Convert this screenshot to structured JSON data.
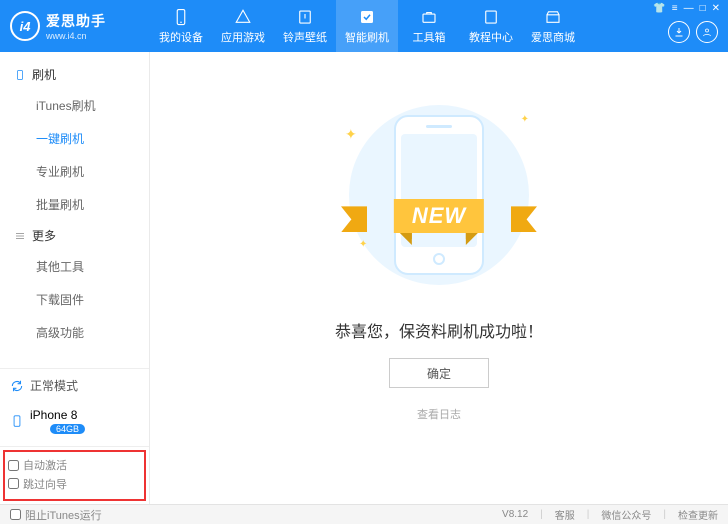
{
  "app": {
    "name": "爱思助手",
    "url": "www.i4.cn",
    "logo_glyph": "i4"
  },
  "nav": [
    {
      "label": "我的设备",
      "icon": "phone"
    },
    {
      "label": "应用游戏",
      "icon": "apps"
    },
    {
      "label": "铃声壁纸",
      "icon": "music"
    },
    {
      "label": "智能刷机",
      "icon": "flash",
      "active": true
    },
    {
      "label": "工具箱",
      "icon": "toolbox"
    },
    {
      "label": "教程中心",
      "icon": "book"
    },
    {
      "label": "爱思商城",
      "icon": "store"
    }
  ],
  "win": {
    "download": "↓",
    "user": "☺"
  },
  "sidebar": {
    "group1": {
      "title": "刷机",
      "items": [
        "iTunes刷机",
        "一键刷机",
        "专业刷机",
        "批量刷机"
      ],
      "active_index": 1
    },
    "group2": {
      "title": "更多",
      "items": [
        "其他工具",
        "下载固件",
        "高级功能"
      ]
    }
  },
  "status": {
    "mode": "正常模式"
  },
  "device": {
    "name": "iPhone 8",
    "capacity": "64GB"
  },
  "options": {
    "auto_activate": "自动激活",
    "skip_wizard": "跳过向导"
  },
  "main": {
    "ribbon": "NEW",
    "success_text": "恭喜您，保资料刷机成功啦！",
    "confirm": "确定",
    "log_link": "查看日志"
  },
  "bottom": {
    "block_itunes": "阻止iTunes运行",
    "version": "V8.12",
    "support": "客服",
    "wechat": "微信公众号",
    "update": "检查更新"
  }
}
